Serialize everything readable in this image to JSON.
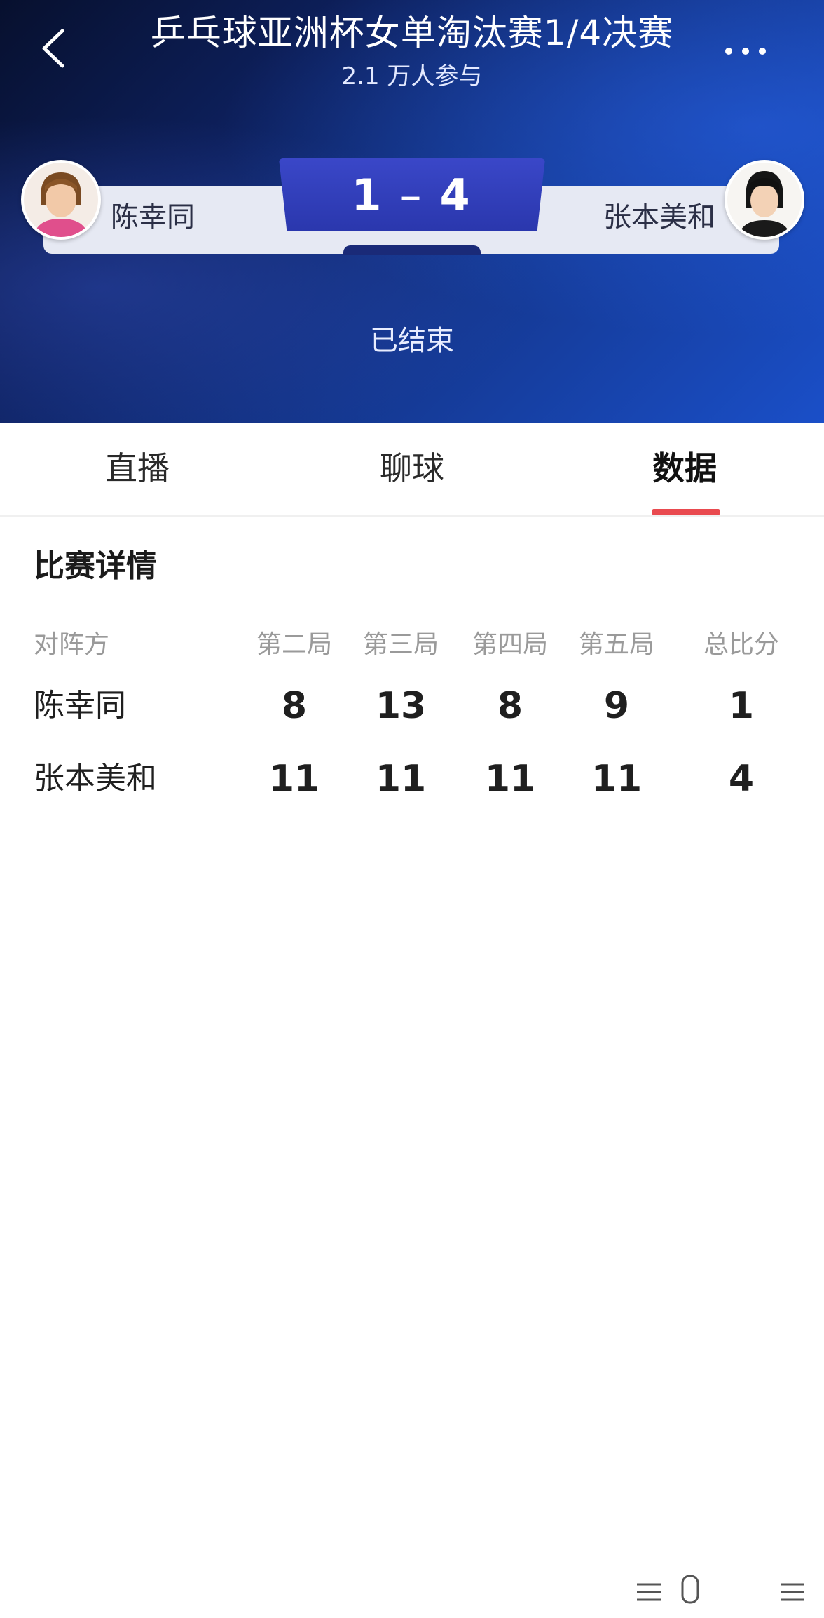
{
  "header": {
    "title": "乒乓球亚洲杯女单淘汰赛1/4决赛",
    "participants": "2.1 万人参与",
    "back_icon": "chevron-left-icon",
    "more_icon": "more-dots-icon"
  },
  "match": {
    "player_left": "陈幸同",
    "player_right": "张本美和",
    "score_left": "1",
    "score_separator": "–",
    "score_right": "4",
    "status": "已结束"
  },
  "tabs": [
    {
      "label": "直播"
    },
    {
      "label": "聊球"
    },
    {
      "label": "数据"
    }
  ],
  "active_tab": "数据",
  "details": {
    "title": "比赛详情",
    "columns": [
      "对阵方",
      "第二局",
      "第三局",
      "第四局",
      "第五局",
      "总比分"
    ],
    "rows": [
      {
        "name": "陈幸同",
        "scores": [
          "8",
          "13",
          "8",
          "9",
          "1"
        ]
      },
      {
        "name": "张本美和",
        "scores": [
          "11",
          "11",
          "11",
          "11",
          "4"
        ]
      }
    ]
  },
  "colors": {
    "accent": "#e94a4f",
    "score_plate": "#2e3bb5",
    "header_dark": "#0d1f5a"
  }
}
